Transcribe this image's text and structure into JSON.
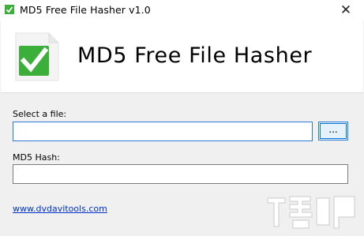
{
  "window": {
    "title": "MD5 Free File Hasher v1.0",
    "close_glyph": "✕"
  },
  "banner": {
    "app_title": "MD5 Free File Hasher",
    "logo_icon": "checkmark-document-icon"
  },
  "form": {
    "file_label": "Select a file:",
    "file_value": "",
    "browse_label": "...",
    "hash_label": "MD5 Hash:",
    "hash_value": ""
  },
  "footer": {
    "link_text": "www.dvdavitools.com"
  },
  "colors": {
    "accent": "#2b7bd6",
    "check_green": "#3cae3a",
    "link": "#0033cc"
  }
}
